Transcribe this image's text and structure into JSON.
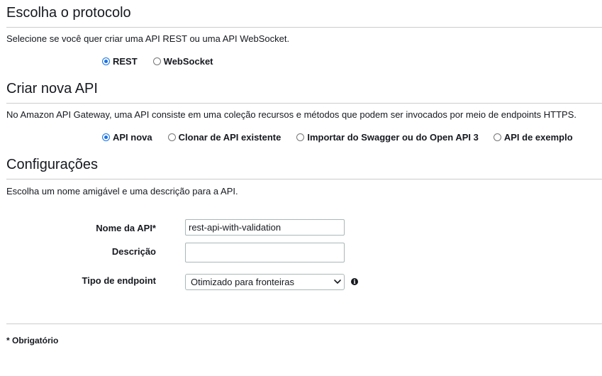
{
  "protocol": {
    "title": "Escolha o protocolo",
    "description": "Selecione se você quer criar uma API REST ou uma API WebSocket.",
    "options": [
      {
        "label": "REST",
        "checked": true
      },
      {
        "label": "WebSocket",
        "checked": false
      }
    ]
  },
  "create_api": {
    "title": "Criar nova API",
    "description": "No Amazon API Gateway, uma API consiste em uma coleção recursos e métodos que podem ser invocados por meio de endpoints HTTPS.",
    "options": [
      {
        "label": "API nova",
        "checked": true
      },
      {
        "label": "Clonar de API existente",
        "checked": false
      },
      {
        "label": "Importar do Swagger ou do Open API 3",
        "checked": false
      },
      {
        "label": "API de exemplo",
        "checked": false
      }
    ]
  },
  "settings": {
    "title": "Configurações",
    "description": "Escolha um nome amigável e uma descrição para a API.",
    "api_name_label": "Nome da API*",
    "api_name_value": "rest-api-with-validation",
    "description_label": "Descrição",
    "description_value": "",
    "endpoint_type_label": "Tipo de endpoint",
    "endpoint_type_value": "Otimizado para fronteiras",
    "info_icon": "info-icon"
  },
  "footer": {
    "required_note": "* Obrigatório"
  },
  "colors": {
    "radio_checked": "#1a73e8",
    "divider": "#cccccc",
    "text": "#16191f"
  }
}
